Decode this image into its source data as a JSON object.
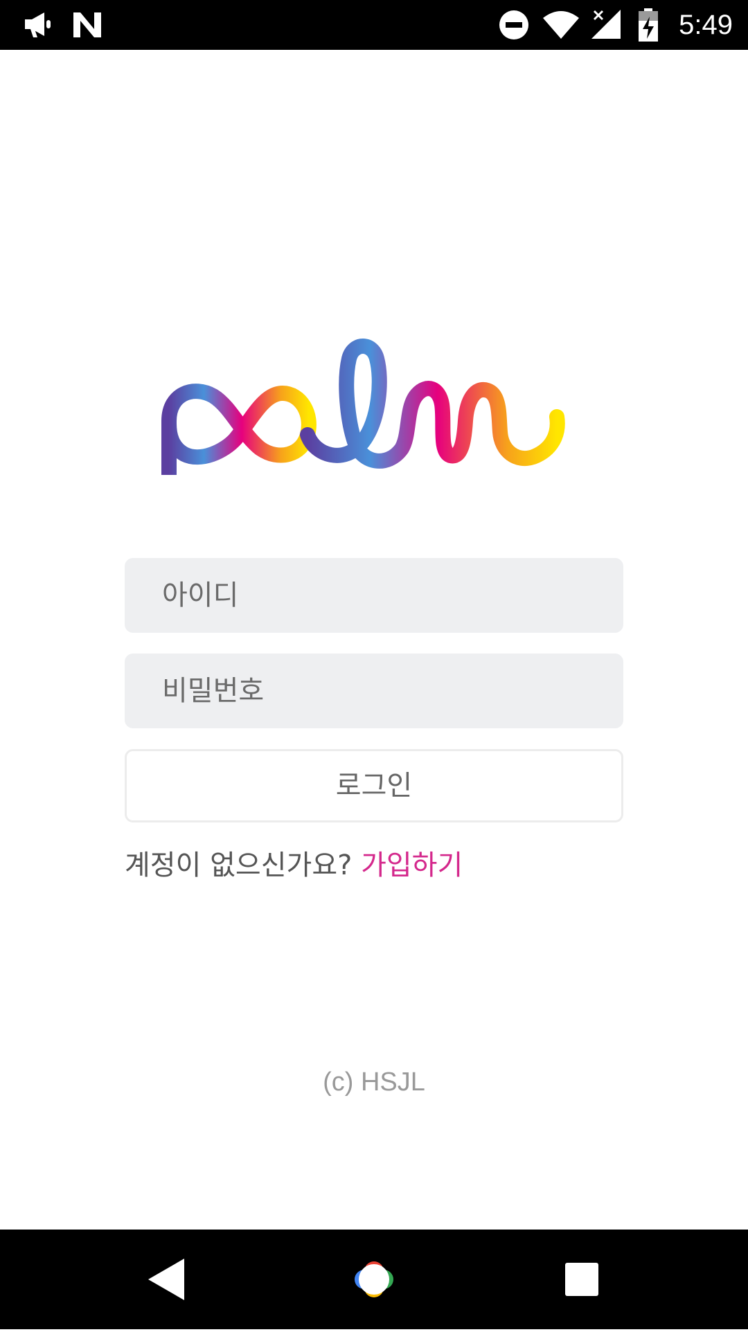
{
  "status_bar": {
    "time": "5:49",
    "icons": [
      "megaphone-icon",
      "n-notification-icon",
      "do-not-disturb-icon",
      "wifi-icon",
      "cell-signal-off-icon",
      "battery-charging-icon"
    ]
  },
  "logo": {
    "text": "palm"
  },
  "form": {
    "id_placeholder": "아이디",
    "password_placeholder": "비밀번호",
    "login_label": "로그인",
    "signup_prompt": "계정이 없으신가요?",
    "signup_link": "가입하기"
  },
  "footer": {
    "copyright": "(c) HSJL"
  },
  "nav_bar": {
    "icons": [
      "back-icon",
      "home-icon",
      "recents-icon"
    ]
  },
  "colors": {
    "accent": "#d4288c",
    "field_bg": "#eeeff1",
    "logo_gradient": [
      "#5b3fa0",
      "#4a90d9",
      "#e6007e",
      "#f7a21b",
      "#ffe600"
    ]
  }
}
